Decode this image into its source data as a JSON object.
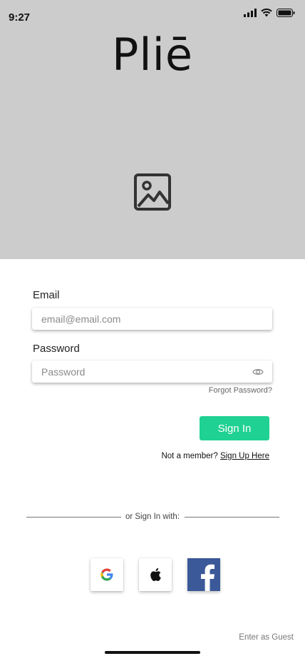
{
  "status_bar": {
    "time": "9:27"
  },
  "hero": {
    "logo_text": "Pliē",
    "placeholder_icon": "image-icon"
  },
  "form": {
    "email_label": "Email",
    "email_placeholder": "email@email.com",
    "password_label": "Password",
    "password_placeholder": "Password",
    "password_toggle_icon": "eye-icon",
    "forgot_password": "Forgot Password?",
    "sign_in_button": "Sign In",
    "not_member_prefix": "Not a member?",
    "sign_up_link": "Sign Up Here"
  },
  "social": {
    "divider_text": "or Sign In with:",
    "providers": [
      {
        "name": "google-icon"
      },
      {
        "name": "apple-icon"
      },
      {
        "name": "facebook-icon"
      }
    ]
  },
  "guest": {
    "label": "Enter as Guest"
  },
  "colors": {
    "hero_bg": "#cccccc",
    "accent": "#1fd192",
    "facebook": "#3b5998"
  }
}
